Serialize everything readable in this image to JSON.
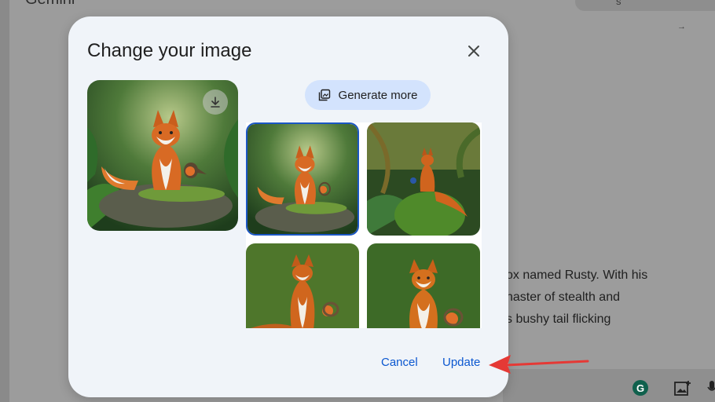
{
  "background": {
    "title": "Gemini",
    "pill_text": "s",
    "lines": [
      "ox named Rusty. With his",
      "naster of stealth and",
      "s bushy tail flicking"
    ]
  },
  "dialog": {
    "title": "Change your image",
    "generate_more_label": "Generate more",
    "cancel_label": "Cancel",
    "update_label": "Update"
  },
  "icons": {
    "close": "close-icon",
    "download": "download-icon",
    "generate": "image-stack-icon"
  },
  "colors": {
    "dialog_bg": "#f0f4f9",
    "accent": "#0b57d0",
    "chip_bg": "#d3e3fd",
    "selection_border": "#1b57c4",
    "annotation_arrow": "#e53935"
  },
  "thumbnails": [
    {
      "id": 1,
      "selected": true
    },
    {
      "id": 2,
      "selected": false
    },
    {
      "id": 3,
      "selected": false
    },
    {
      "id": 4,
      "selected": false
    }
  ]
}
